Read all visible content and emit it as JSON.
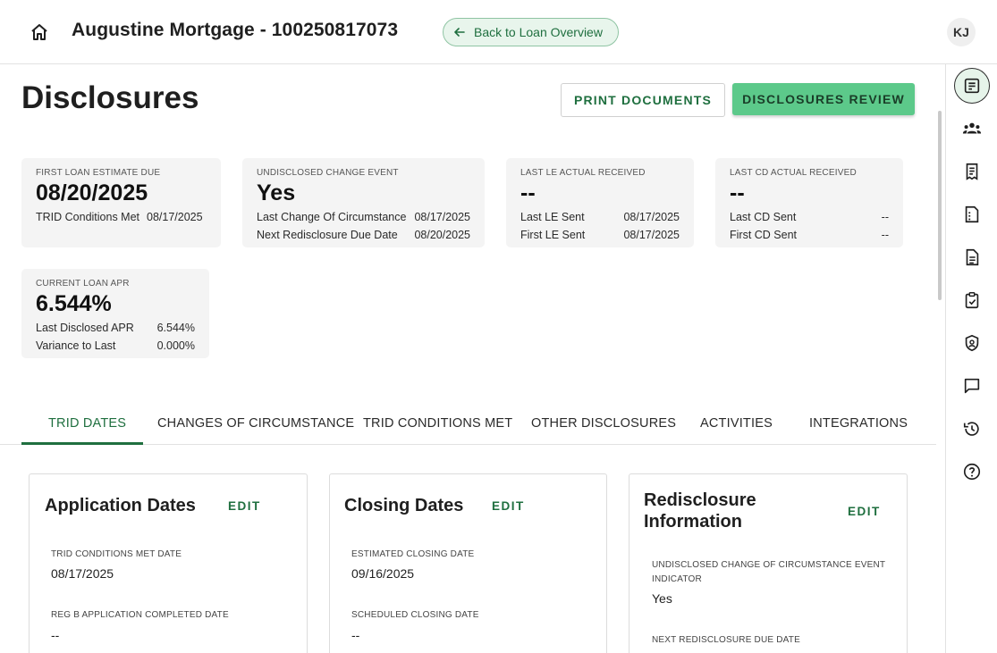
{
  "header": {
    "title": "Augustine Mortgage - 100250817073",
    "back_label": "Back to Loan Overview",
    "avatar_initials": "KJ"
  },
  "page": {
    "title": "Disclosures",
    "print_label": "PRINT DOCUMENTS",
    "review_label": "DISCLOSURES REVIEW"
  },
  "cards": {
    "first_le": {
      "label": "FIRST LOAN ESTIMATE DUE",
      "value": "08/20/2025",
      "rows": [
        {
          "label": "TRID Conditions Met",
          "value": "08/17/2025"
        }
      ]
    },
    "undisclosed": {
      "label": "UNDISCLOSED CHANGE EVENT",
      "value": "Yes",
      "rows": [
        {
          "label": "Last Change Of Circumstance",
          "value": "08/17/2025"
        },
        {
          "label": "Next Redisclosure Due Date",
          "value": "08/20/2025"
        }
      ]
    },
    "last_le": {
      "label": "LAST LE ACTUAL RECEIVED",
      "value": "--",
      "rows": [
        {
          "label": "Last LE Sent",
          "value": "08/17/2025"
        },
        {
          "label": "First LE Sent",
          "value": "08/17/2025"
        }
      ]
    },
    "last_cd": {
      "label": "LAST CD ACTUAL RECEIVED",
      "value": "--",
      "rows": [
        {
          "label": "Last CD Sent",
          "value": "--"
        },
        {
          "label": "First CD Sent",
          "value": "--"
        }
      ]
    },
    "apr": {
      "label": "CURRENT LOAN APR",
      "value": "6.544%",
      "rows": [
        {
          "label": "Last Disclosed APR",
          "value": "6.544%"
        },
        {
          "label": "Variance to Last",
          "value": "0.000%"
        }
      ]
    }
  },
  "tabs": [
    {
      "label": "TRID DATES"
    },
    {
      "label": "CHANGES OF CIRCUMSTANCE"
    },
    {
      "label": "TRID CONDITIONS MET"
    },
    {
      "label": "OTHER DISCLOSURES"
    },
    {
      "label": "ACTIVITIES"
    },
    {
      "label": "INTEGRATIONS"
    }
  ],
  "panels": {
    "application": {
      "title": "Application Dates",
      "edit": "EDIT",
      "fields": [
        {
          "label": "TRID CONDITIONS MET DATE",
          "value": "08/17/2025"
        },
        {
          "label": "REG B APPLICATION COMPLETED DATE",
          "value": "--"
        }
      ]
    },
    "closing": {
      "title": "Closing Dates",
      "edit": "EDIT",
      "fields": [
        {
          "label": "ESTIMATED CLOSING DATE",
          "value": "09/16/2025"
        },
        {
          "label": "SCHEDULED CLOSING DATE",
          "value": "--"
        }
      ]
    },
    "redisclosure": {
      "title_line1": "Redisclosure",
      "title_line2": "Information",
      "edit": "EDIT",
      "fields": [
        {
          "label_line1": "UNDISCLOSED CHANGE OF CIRCUMSTANCE EVENT",
          "label_line2": "INDICATOR",
          "value": "Yes"
        },
        {
          "label": "NEXT REDISCLOSURE DUE DATE"
        }
      ]
    }
  },
  "icons": {
    "home": "home-icon",
    "back": "arrow-left-icon",
    "rail": [
      "disclosures-icon",
      "people-icon",
      "receipt-icon",
      "checklist-doc-icon",
      "document-icon",
      "clipboard-check-icon",
      "shield-person-icon",
      "chat-icon",
      "history-icon",
      "help-icon"
    ]
  },
  "colors": {
    "accent": "#1f6f3f",
    "review_button": "#5cc98a",
    "back_button_bg": "#e8f5ec"
  }
}
